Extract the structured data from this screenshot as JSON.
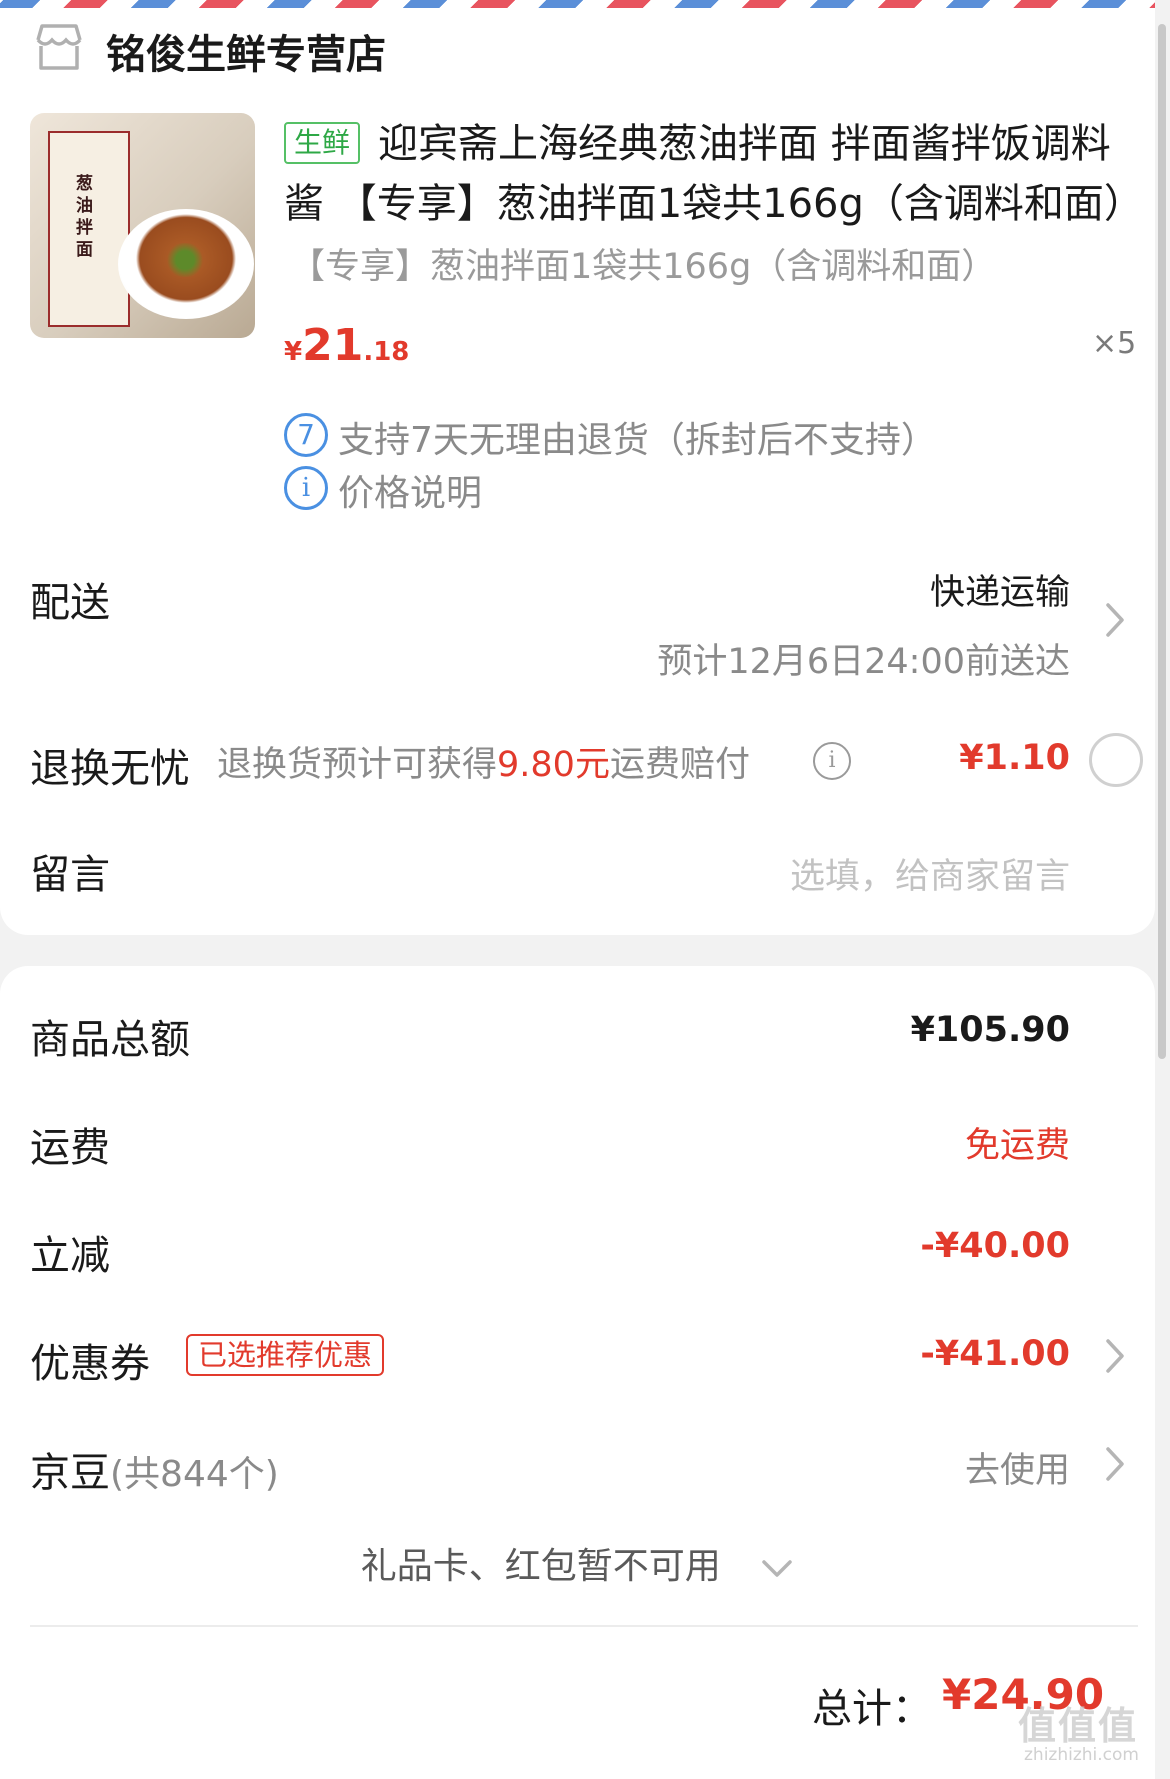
{
  "store": {
    "name": "铭俊生鲜专营店",
    "icon": "store-icon"
  },
  "product": {
    "tag": "生鲜",
    "title": "迎宾斋上海经典葱油拌面 拌面酱拌饭调料酱 【专享】葱油拌面1袋共166g（含调料和面）",
    "spec": "【专享】葱油拌面1袋共166g（含调料和面）",
    "package_text": "葱油拌面",
    "price_currency": "¥",
    "price_int": "21",
    "price_dec": ".18",
    "quantity": "×5",
    "service_badge": "7",
    "service_text": "支持7天无理由退货（拆封后不支持）",
    "price_note_icon": "i",
    "price_note": "价格说明"
  },
  "delivery": {
    "label": "配送",
    "method": "快递运输",
    "eta": "预计12月6日24:00前送达"
  },
  "return_insurance": {
    "label": "退换无忧",
    "desc_pre": "退换货预计可获得",
    "desc_amount": "9.80元",
    "desc_post": "运费赔付",
    "info_icon": "i",
    "price": "¥1.10"
  },
  "message": {
    "label": "留言",
    "placeholder": "选填，给商家留言"
  },
  "summary": {
    "goods_total_label": "商品总额",
    "goods_total": "¥105.90",
    "shipping_label": "运费",
    "shipping": "免运费",
    "discount_label": "立减",
    "discount": "-¥40.00",
    "coupon_label": "优惠券",
    "coupon_badge": "已选推荐优惠",
    "coupon": "-¥41.00",
    "beans_label": "京豆",
    "beans_count": "(共844个)",
    "beans_action": "去使用",
    "gift_card": "礼品卡、红包暂不可用",
    "total_label": "总计：",
    "total": "¥24.90"
  },
  "watermark": {
    "text": "值值值",
    "sub": "zhizhizhi.com"
  },
  "colors": {
    "accent_red": "#e23a2c",
    "fresh_green": "#2ea846",
    "info_blue": "#4a90e2"
  }
}
